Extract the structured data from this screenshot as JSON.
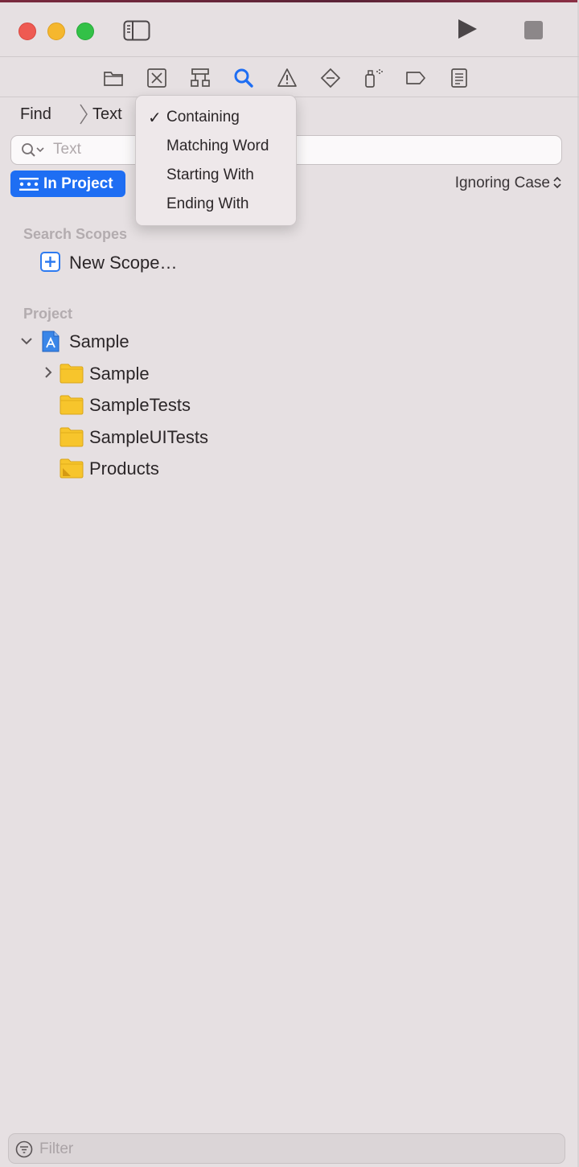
{
  "toolbar": {
    "run_icon": "play-icon",
    "stop_icon": "stop-icon",
    "sidebar_icon": "sidebar-toggle-icon"
  },
  "navigator_icons": [
    "folder-icon",
    "source-control-icon",
    "symbol-hierarchy-icon",
    "search-icon",
    "warning-icon",
    "test-diamond-icon",
    "debug-spray-icon",
    "breakpoint-tag-icon",
    "report-list-icon"
  ],
  "find": {
    "mode_label": "Find",
    "type_label": "Text",
    "search_placeholder": "Text",
    "scope_button_label": "In Project",
    "case_label": "Ignoring Case"
  },
  "match_menu": {
    "items": [
      {
        "label": "Containing",
        "checked": true
      },
      {
        "label": "Matching Word",
        "checked": false
      },
      {
        "label": "Starting With",
        "checked": false
      },
      {
        "label": "Ending With",
        "checked": false
      }
    ],
    "check_glyph": "✓"
  },
  "search_scopes": {
    "heading": "Search Scopes",
    "new_scope_label": "New Scope…"
  },
  "project": {
    "heading": "Project",
    "root": "Sample",
    "children": [
      "Sample",
      "SampleTests",
      "SampleUITests",
      "Products"
    ]
  },
  "filter": {
    "placeholder": "Filter"
  },
  "colors": {
    "accent": "#1e6ef3",
    "folder": "#f7c52c",
    "background": "#e6e0e2"
  }
}
